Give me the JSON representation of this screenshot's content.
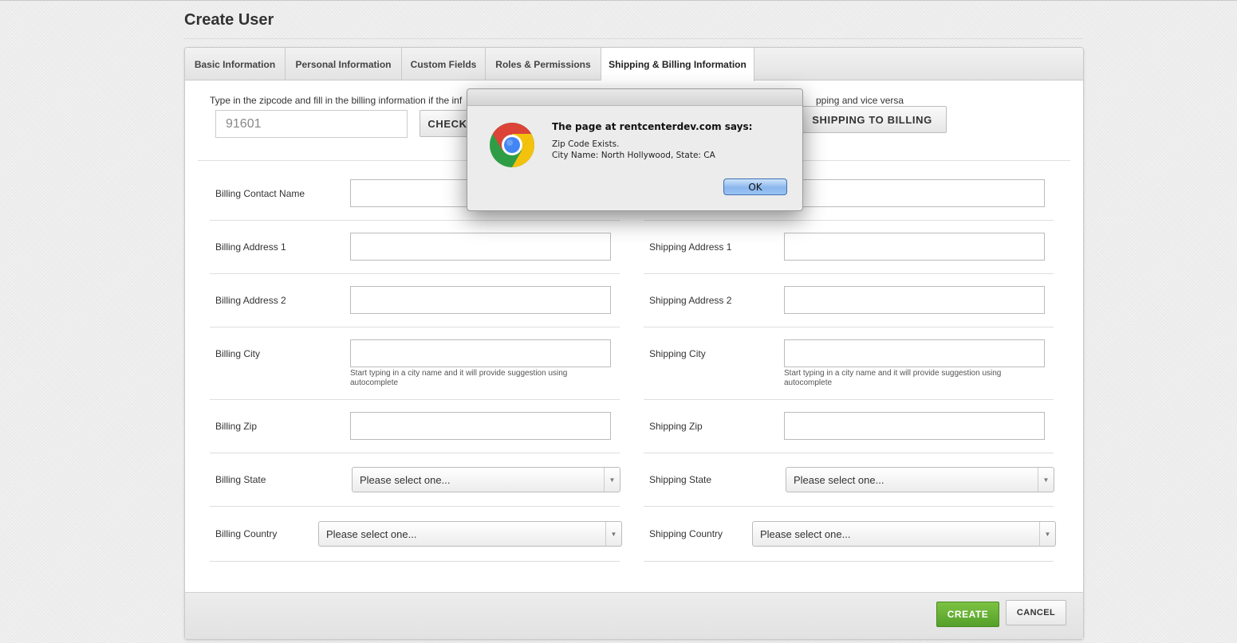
{
  "page": {
    "title": "Create User"
  },
  "tabs": [
    {
      "label": "Basic Information"
    },
    {
      "label": "Personal Information"
    },
    {
      "label": "Custom Fields"
    },
    {
      "label": "Roles & Permissions"
    },
    {
      "label": "Shipping & Billing Information",
      "active": true
    }
  ],
  "zip": {
    "instructions_left": "Type in the zipcode and fill in the billing information if the inf",
    "instructions_right": "pping and vice versa",
    "value": "91601",
    "check_button": "CHECK",
    "copy_button": "SHIPPING TO BILLING"
  },
  "billing": {
    "contact_name": "Billing Contact Name",
    "address1": "Billing Address 1",
    "address2": "Billing Address 2",
    "city": "Billing City",
    "city_help": "Start typing in a city name and it will provide suggestion using autocomplete",
    "zip": "Billing Zip",
    "state": "Billing State",
    "state_value": "Please select one...",
    "country": "Billing Country",
    "country_value": "Please select one..."
  },
  "shipping": {
    "address1": "Shipping Address 1",
    "address2": "Shipping Address 2",
    "city": "Shipping City",
    "city_help": "Start typing in a city name and it will provide suggestion using autocomplete",
    "zip": "Shipping Zip",
    "state": "Shipping State",
    "state_value": "Please select one...",
    "country": "Shipping Country",
    "country_value": "Please select one..."
  },
  "footer": {
    "create": "CREATE",
    "cancel": "CANCEL"
  },
  "dialog": {
    "heading": "The page at rentcenterdev.com says:",
    "line1": "Zip Code Exists.",
    "line2": "City Name: North Hollywood, State: CA",
    "ok": "OK",
    "icon": "chrome-icon"
  },
  "colors": {
    "create_button": "#5fa832",
    "ok_button": "#8ab6ee"
  }
}
